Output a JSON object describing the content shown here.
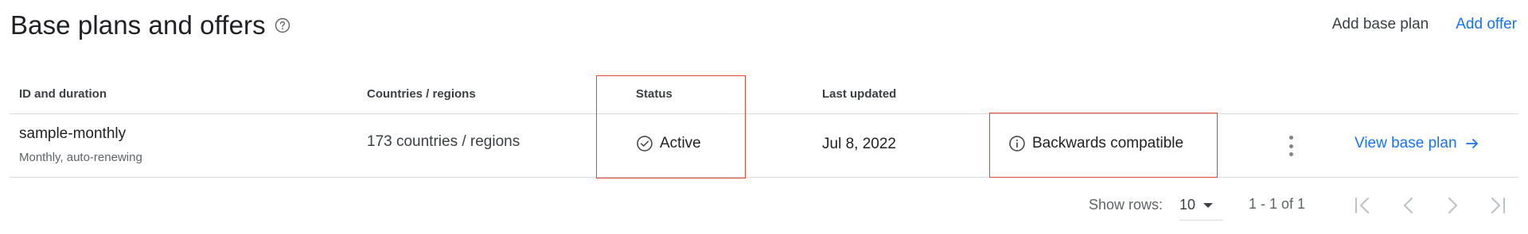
{
  "header": {
    "title": "Base plans and offers",
    "help_icon": "help-circle-icon",
    "add_base_plan_label": "Add base plan",
    "add_offer_label": "Add offer"
  },
  "table": {
    "columns": [
      "ID and duration",
      "Countries / regions",
      "Status",
      "Last updated"
    ],
    "rows": [
      {
        "id": "sample-monthly",
        "duration": "Monthly, auto-renewing",
        "countries": "173 countries / regions",
        "status": "Active",
        "status_icon": "check-circle-icon",
        "last_updated": "Jul 8, 2022",
        "compat": "Backwards compatible",
        "compat_icon": "info-circle-icon",
        "more_icon": "more-vertical-icon",
        "view_label": "View base plan",
        "view_icon": "arrow-right-icon"
      }
    ]
  },
  "pagination": {
    "show_rows_label": "Show rows:",
    "rows_per_page": "10",
    "range": "1 - 1 of 1"
  },
  "colors": {
    "accent": "#1a73e8",
    "highlight": "#e0453a",
    "divider": "#dadce0",
    "text_primary": "#202124",
    "text_secondary": "#5f6368",
    "disabled": "#bdc1c6"
  }
}
